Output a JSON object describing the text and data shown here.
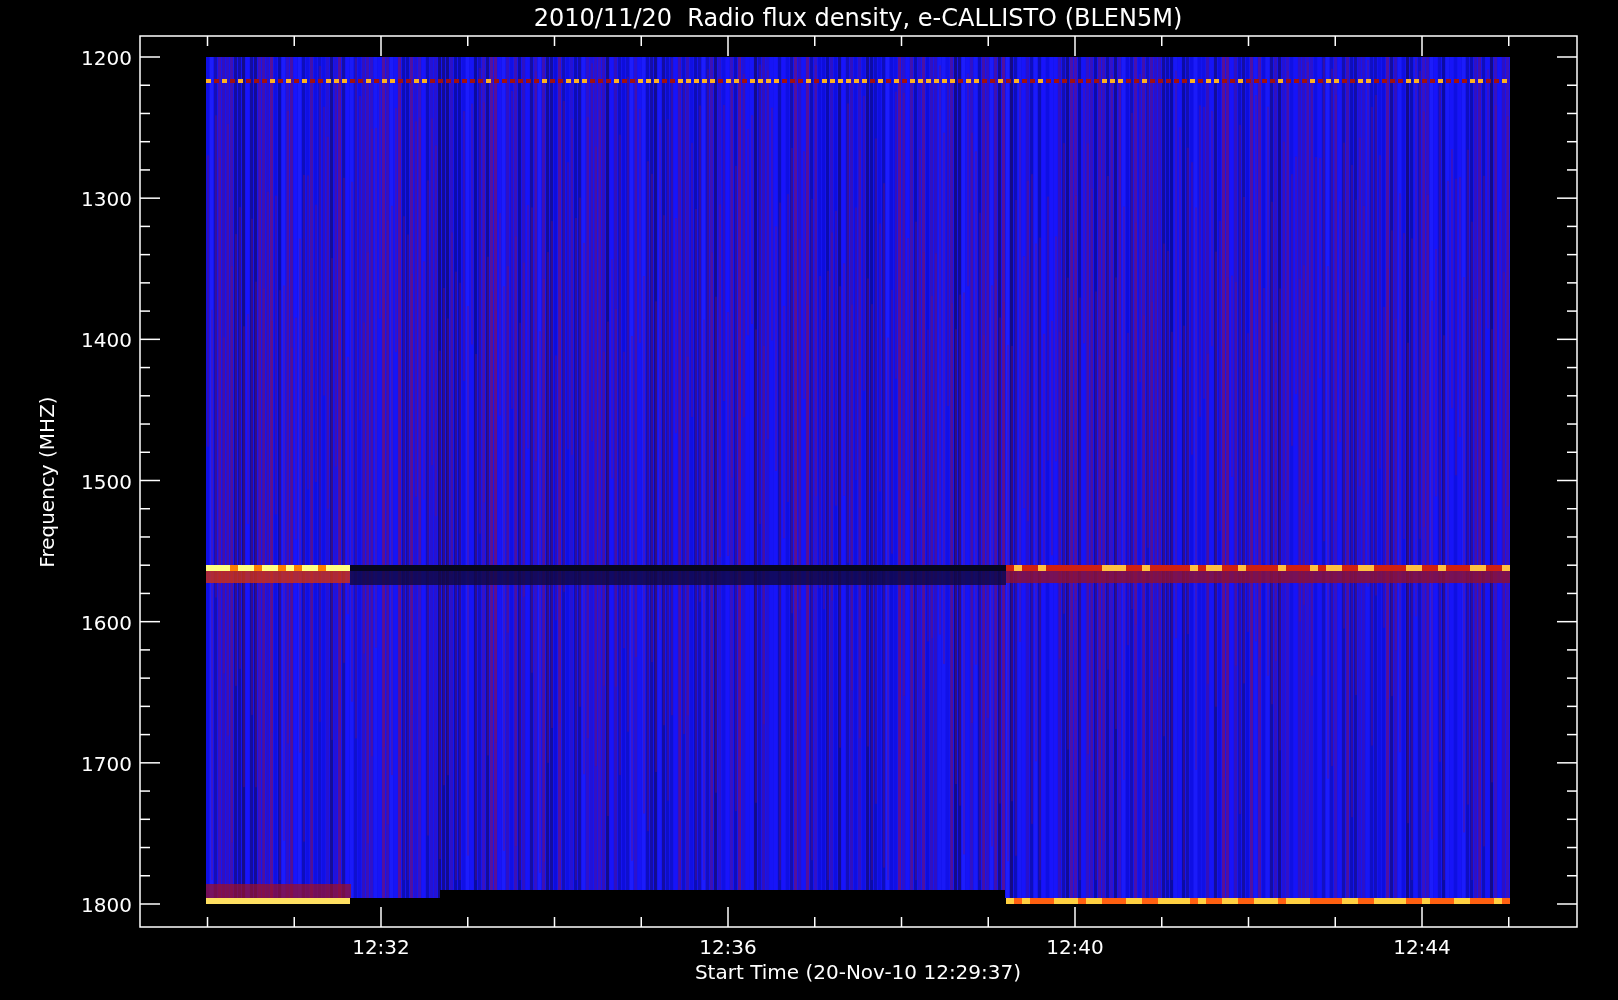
{
  "title": "2010/11/20  Radio flux density, e-CALLISTO (BLEN5M)",
  "plot": {
    "ylabel": "Frequency (MHZ)",
    "xlabel": "Start Time (20-Nov-10 12:29:37)",
    "yticks": [
      "1200",
      "1300",
      "1400",
      "1500",
      "1600",
      "1700",
      "1800"
    ],
    "xticks": [
      "12:32",
      "12:36",
      "12:40",
      "12:44"
    ]
  }
}
